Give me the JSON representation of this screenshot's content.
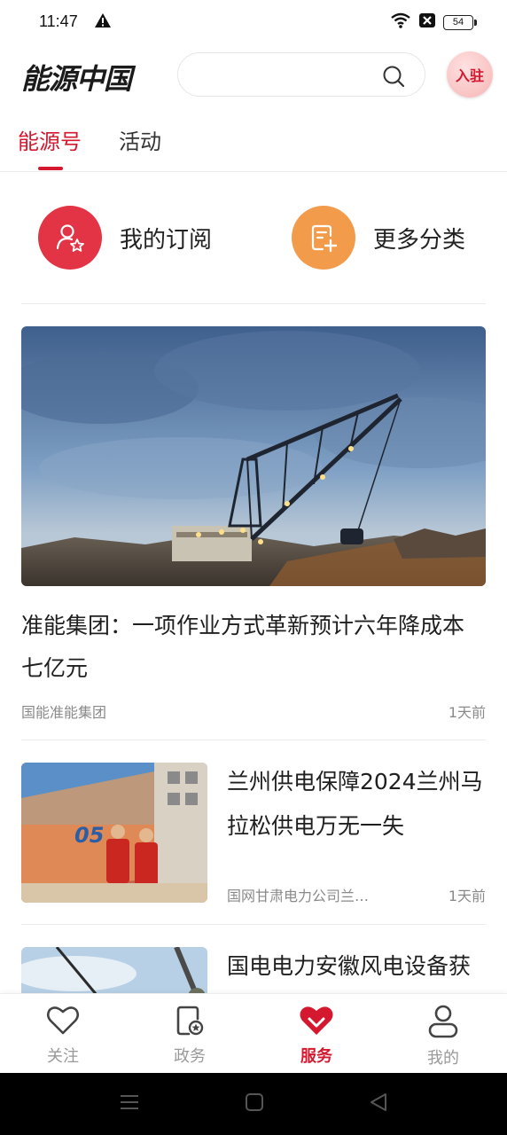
{
  "status_bar": {
    "time": "11:47",
    "battery": "54"
  },
  "header": {
    "logo": "能源中国",
    "search": {
      "placeholder": ""
    },
    "join_label": "入驻"
  },
  "tabs": [
    {
      "label": "能源号",
      "active": true
    },
    {
      "label": "活动",
      "active": false
    }
  ],
  "quick_actions": [
    {
      "label": "我的订阅",
      "icon": "user-star-icon",
      "color": "#e23445"
    },
    {
      "label": "更多分类",
      "icon": "add-note-icon",
      "color": "#f29b4b"
    }
  ],
  "feed": {
    "hero": {
      "title": "准能集团：一项作业方式革新预计六年降成本七亿元",
      "source": "国能准能集团",
      "time": "1天前",
      "image": "dragline-excavator-photo"
    },
    "articles": [
      {
        "title": "兰州供电保障2024兰州马拉松供电万无一失",
        "source": "国网甘肃电力公司兰…",
        "time": "1天前",
        "image": "marathon-workers-photo"
      },
      {
        "title": "国电电力安徽风电设备获得“体检”策府安全",
        "source": "",
        "time": "",
        "image": "wind-turbine-photo"
      }
    ]
  },
  "bottom_nav": [
    {
      "label": "关注",
      "icon": "heart-icon",
      "active": false
    },
    {
      "label": "政务",
      "icon": "gov-doc-icon",
      "active": false
    },
    {
      "label": "服务",
      "icon": "service-heart-icon",
      "active": true
    },
    {
      "label": "我的",
      "icon": "profile-icon",
      "active": false
    }
  ],
  "colors": {
    "accent": "#d3182f",
    "orange": "#f29b4b",
    "red_circle": "#e23445"
  }
}
